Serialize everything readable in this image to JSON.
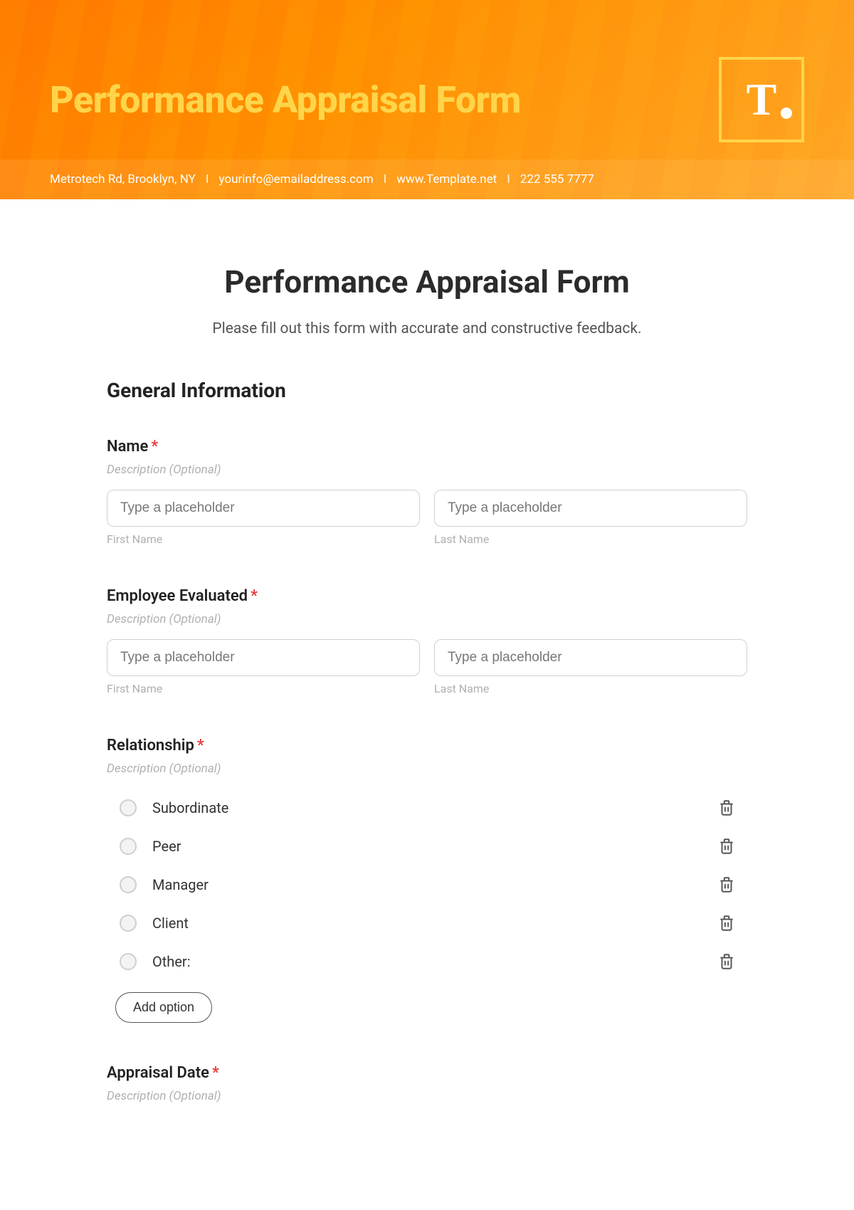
{
  "banner": {
    "title": "Performance Appraisal Form",
    "logo_letter": "T",
    "address": "Metrotech Rd, Brooklyn, NY",
    "email": "yourinfo@emailaddress.com",
    "website": "www.Template.net",
    "phone": "222 555 7777",
    "separator": "I"
  },
  "form": {
    "title": "Performance Appraisal Form",
    "subtitle": "Please fill out this form with accurate and constructive feedback.",
    "section_heading": "General Information",
    "description_placeholder": "Description (Optional)",
    "input_placeholder": "Type a placeholder",
    "first_name_label": "First Name",
    "last_name_label": "Last Name",
    "required_mark": "*",
    "add_option_label": "Add option",
    "fields": {
      "name": {
        "label": "Name"
      },
      "employee_evaluated": {
        "label": "Employee Evaluated"
      },
      "relationship": {
        "label": "Relationship",
        "options": [
          "Subordinate",
          "Peer",
          "Manager",
          "Client",
          "Other:"
        ]
      },
      "appraisal_date": {
        "label": "Appraisal Date"
      }
    }
  }
}
